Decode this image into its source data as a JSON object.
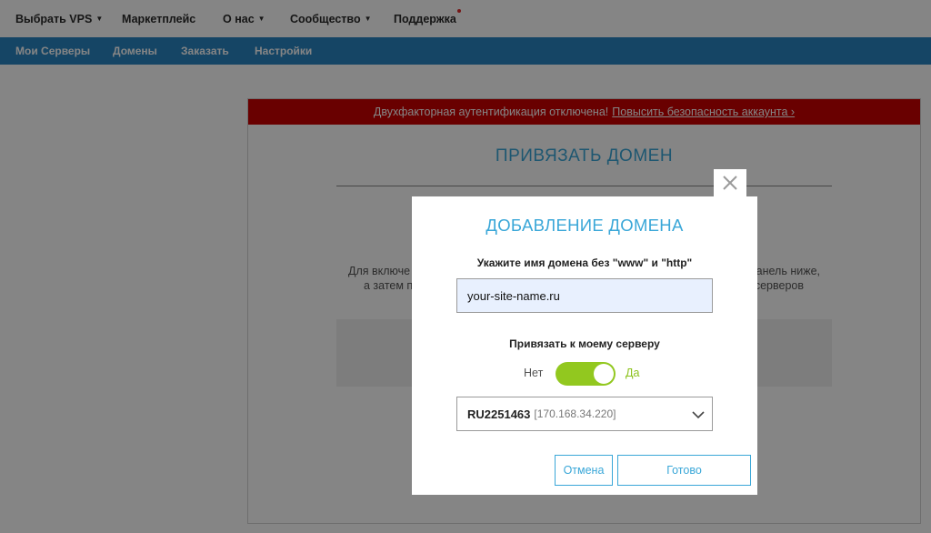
{
  "topnav": {
    "items": [
      {
        "label": "Выбрать VPS",
        "has_caret": true
      },
      {
        "label": "Маркетплейс",
        "has_caret": false
      },
      {
        "label": "О нас",
        "has_caret": true
      },
      {
        "label": "Сообщество",
        "has_caret": true
      },
      {
        "label": "Поддержка",
        "has_caret": false
      }
    ],
    "caret_glyph": "▼"
  },
  "subnav": {
    "items": [
      {
        "label": "Мои Серверы"
      },
      {
        "label": "Домены"
      },
      {
        "label": "Заказать"
      },
      {
        "label": "Настройки"
      }
    ]
  },
  "alert": {
    "text": "Двухфакторная аутентификация отключена!",
    "link": "Повысить безопасность аккаунта ›"
  },
  "panel": {
    "title": "ПРИВЯЗАТЬ ДОМЕН",
    "text_line1": "Для включе",
    "text_line1_end": "анель ниже,",
    "text_line2": "а затем п",
    "text_line2_end": "серверов"
  },
  "modal": {
    "title": "ДОБАВЛЕНИЕ ДОМЕНА",
    "domain_label": "Укажите имя домена без \"www\" и \"http\"",
    "domain_value": "your-site-name.ru",
    "bind_label": "Привязать к моему серверу",
    "toggle_off_label": "Нет",
    "toggle_on_label": "Да",
    "toggle_on": true,
    "server_name": "RU2251463",
    "server_ip": "[170.168.34.220]",
    "cancel_label": "Отмена",
    "done_label": "Готово"
  },
  "colors": {
    "accent": "#3aa7d8",
    "subnav_bg": "#2a84c2",
    "alert_bg": "#c90000",
    "toggle_on": "#92c81f"
  }
}
